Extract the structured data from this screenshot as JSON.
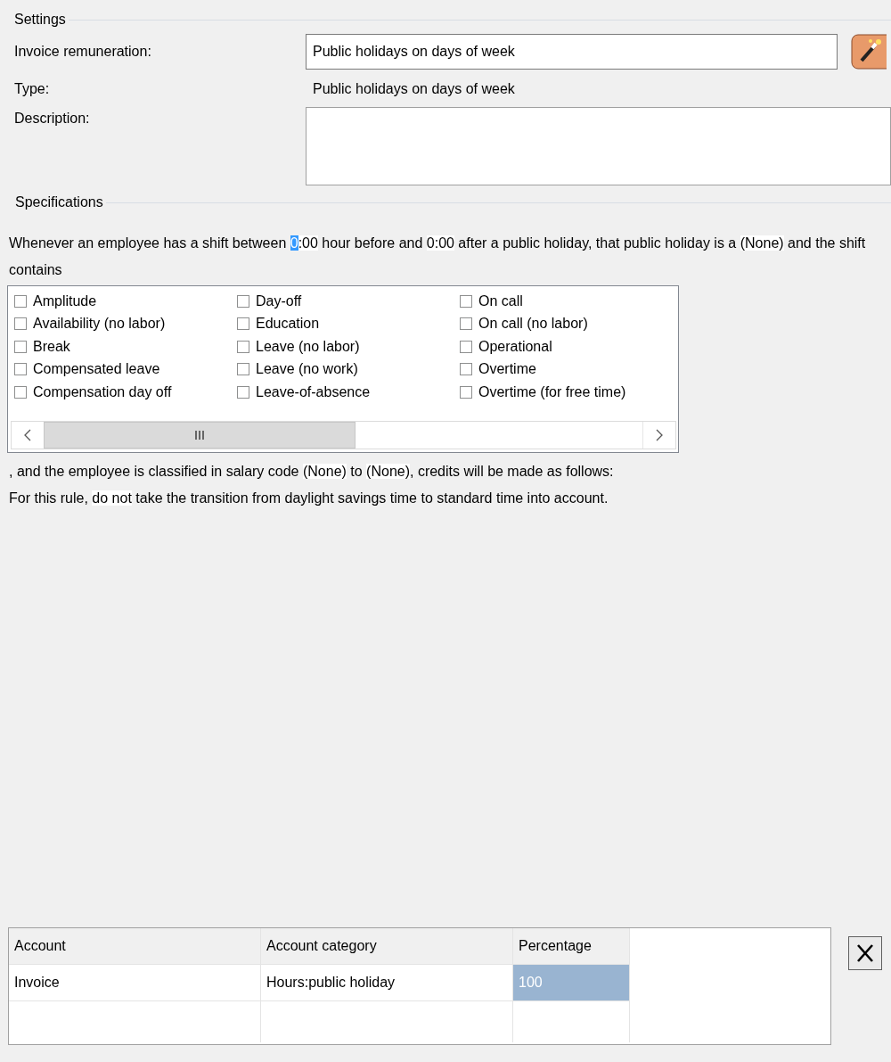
{
  "settings": {
    "title": "Settings",
    "fields": [
      {
        "label": "Invoice remuneration:",
        "kind": "input",
        "value": "Public holidays on days of week"
      },
      {
        "label": "Type:",
        "kind": "static",
        "value": "Public holidays on days of week"
      },
      {
        "label": "Description:",
        "kind": "textarea"
      }
    ]
  },
  "specifications": {
    "title": "Specifications",
    "sentence": [
      {
        "kind": "text",
        "text": "Whenever an employee has a shift between "
      },
      {
        "kind": "field",
        "text": "0:00",
        "selected": true
      },
      {
        "kind": "text",
        "text": " hour before and "
      },
      {
        "kind": "field",
        "text": "0:00",
        "selected": false
      },
      {
        "kind": "text",
        "text": " after a public holiday, that public holiday is a "
      },
      {
        "kind": "field",
        "text": "(None)",
        "selected": false
      },
      {
        "kind": "text",
        "text": " and the shift contains"
      }
    ],
    "shift_types": [
      {
        "label": "Amplitude",
        "checked": false
      },
      {
        "label": "Availability (no labor)",
        "checked": false
      },
      {
        "label": "Break",
        "checked": false
      },
      {
        "label": "Compensated leave",
        "checked": false
      },
      {
        "label": "Compensation day off",
        "checked": false
      },
      {
        "label": "Day-off",
        "checked": false
      },
      {
        "label": "Education",
        "checked": false
      },
      {
        "label": "Leave (no labor)",
        "checked": false
      },
      {
        "label": "Leave (no work)",
        "checked": false
      },
      {
        "label": "Leave-of-absence",
        "checked": false
      },
      {
        "label": "On call",
        "checked": false
      },
      {
        "label": "On call (no labor)",
        "checked": false
      },
      {
        "label": "Operational",
        "checked": false
      },
      {
        "label": "Overtime",
        "checked": false
      },
      {
        "label": "Overtime (for free time)",
        "checked": false
      }
    ],
    "sentence_2": [
      {
        "kind": "text",
        "text": ", and the employee is classified in salary code "
      },
      {
        "kind": "field",
        "text": "(None)",
        "selected": false
      },
      {
        "kind": "text",
        "text": " to "
      },
      {
        "kind": "field",
        "text": "(None)",
        "selected": false
      },
      {
        "kind": "text",
        "text": ", credits will be made as follows:"
      }
    ],
    "sentence_3": [
      {
        "kind": "text",
        "text": "For this rule, "
      },
      {
        "kind": "field",
        "text": "do not",
        "selected": false
      },
      {
        "kind": "text",
        "text": " take the transition from daylight savings time to standard time into account."
      }
    ]
  },
  "table": {
    "columns": [
      "Account",
      "Account category",
      "Percentage"
    ],
    "rows": [
      {
        "cells": [
          {
            "text": "Invoice",
            "selected": false
          },
          {
            "text": "Hours:public holiday",
            "selected": false
          },
          {
            "text": "100",
            "selected": true
          }
        ]
      }
    ]
  }
}
